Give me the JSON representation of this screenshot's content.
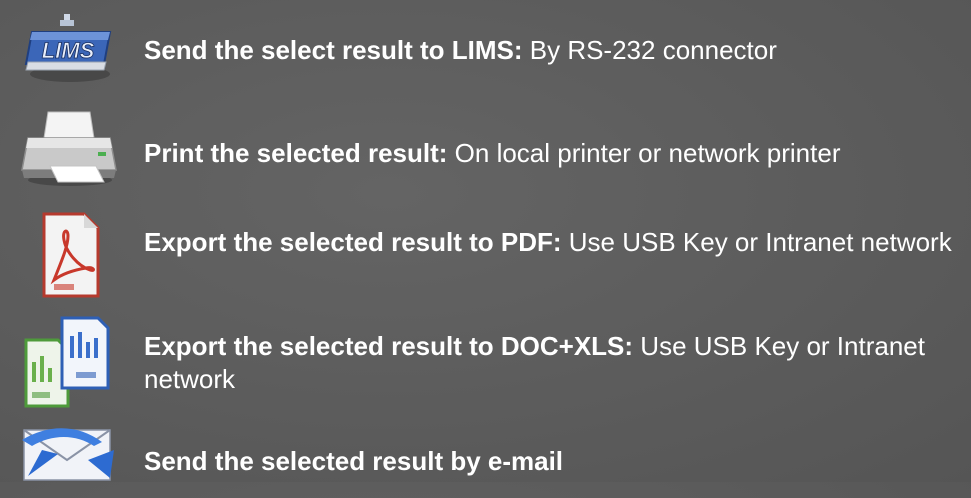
{
  "items": [
    {
      "title": "Send the select result to LIMS:",
      "description": "By RS-232 connector",
      "icon": "lims-icon",
      "icon_text": "LIMS"
    },
    {
      "title": "Print the selected result:",
      "description": "On local printer or network printer",
      "icon": "printer-icon"
    },
    {
      "title": "Export the selected result to PDF:",
      "description": "Use USB Key or Intranet network",
      "icon": "pdf-icon"
    },
    {
      "title": "Export the selected result to DOC+XLS:",
      "description": "Use USB Key or Intranet network",
      "icon": "doc-xls-icon"
    },
    {
      "title": "Send the selected result by e-mail",
      "description": "",
      "icon": "email-icon"
    }
  ],
  "colors": {
    "background": "#5d5d5d",
    "text": "#ffffff"
  }
}
